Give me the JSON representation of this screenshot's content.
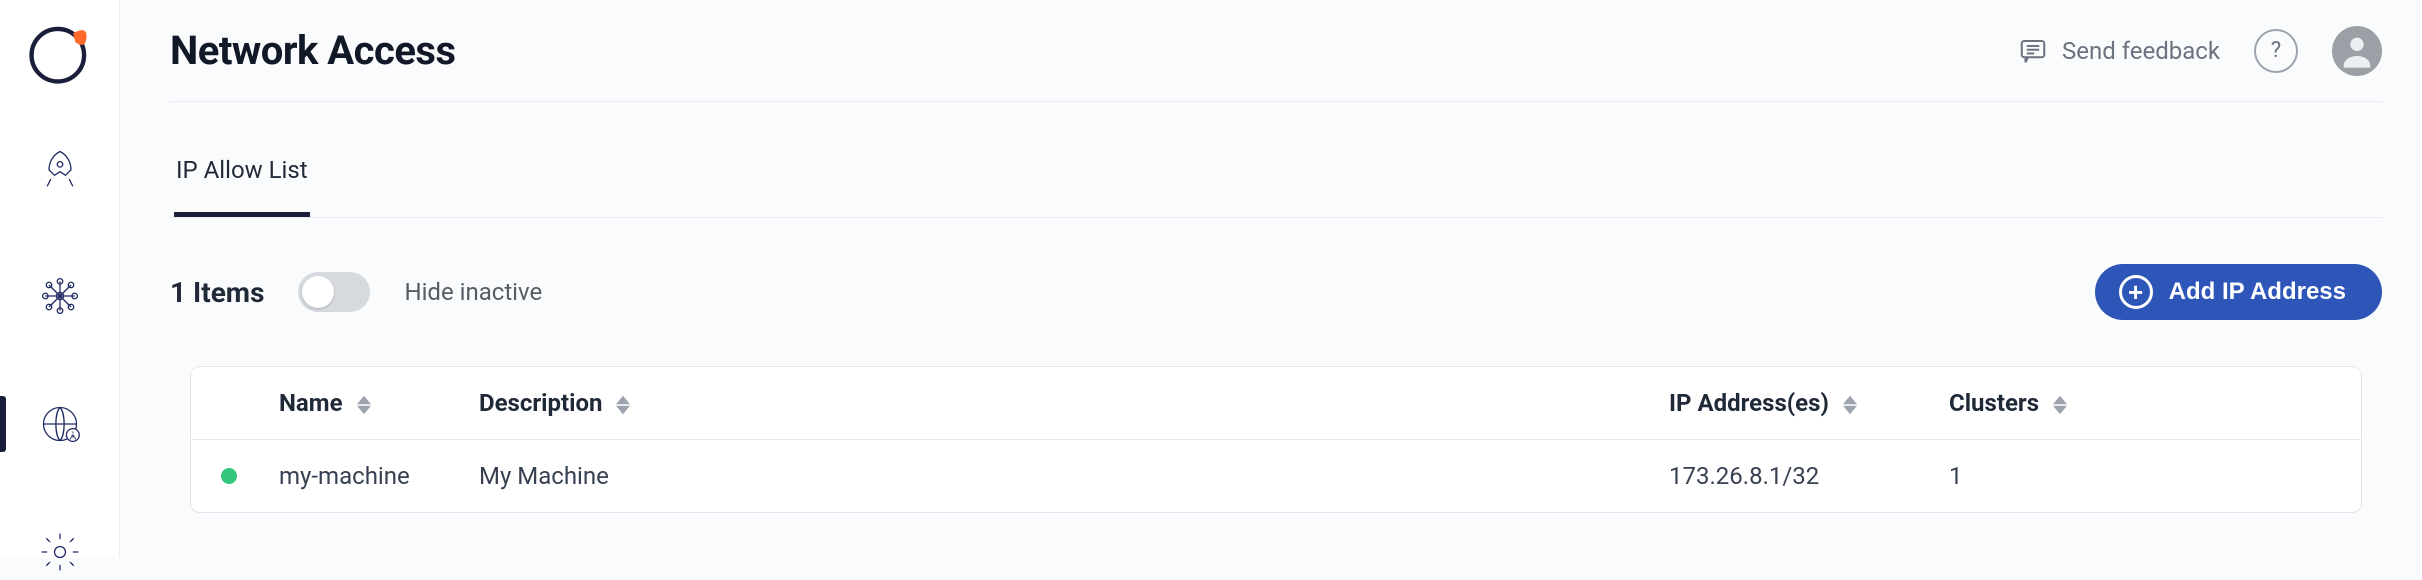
{
  "header": {
    "title": "Network Access",
    "feedback_label": "Send feedback"
  },
  "tabs": [
    {
      "label": "IP Allow List",
      "active": true
    }
  ],
  "toolbar": {
    "items_count_label": "1 Items",
    "hide_inactive_label": "Hide inactive",
    "add_button_label": "Add IP Address"
  },
  "table": {
    "columns": {
      "name": "Name",
      "description": "Description",
      "ip": "IP Address(es)",
      "clusters": "Clusters"
    },
    "rows": [
      {
        "status": "active",
        "name": "my-machine",
        "description": "My Machine",
        "ip": "173.26.8.1/32",
        "clusters": "1"
      }
    ]
  }
}
